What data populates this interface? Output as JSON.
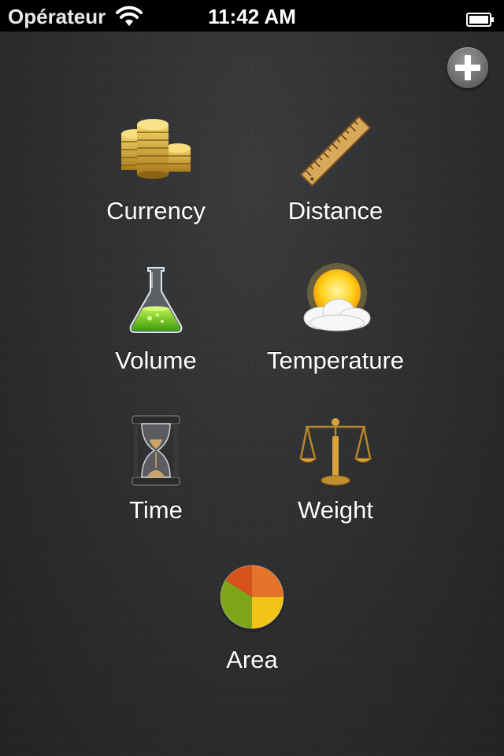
{
  "status_bar": {
    "carrier": "Opérateur",
    "time": "11:42 AM",
    "wifi_icon": "wifi-icon",
    "battery_icon": "battery-icon"
  },
  "toolbar": {
    "add_icon": "plus-icon"
  },
  "categories": [
    {
      "label": "Currency",
      "icon": "coins-icon"
    },
    {
      "label": "Distance",
      "icon": "ruler-icon"
    },
    {
      "label": "Volume",
      "icon": "flask-icon"
    },
    {
      "label": "Temperature",
      "icon": "sun-cloud-icon"
    },
    {
      "label": "Time",
      "icon": "hourglass-icon"
    },
    {
      "label": "Weight",
      "icon": "scale-icon"
    },
    {
      "label": "Area",
      "icon": "pie-chart-icon"
    }
  ],
  "colors": {
    "background": "#2a2b2c",
    "status_bar": "#000000",
    "label_text": "#ffffff"
  }
}
